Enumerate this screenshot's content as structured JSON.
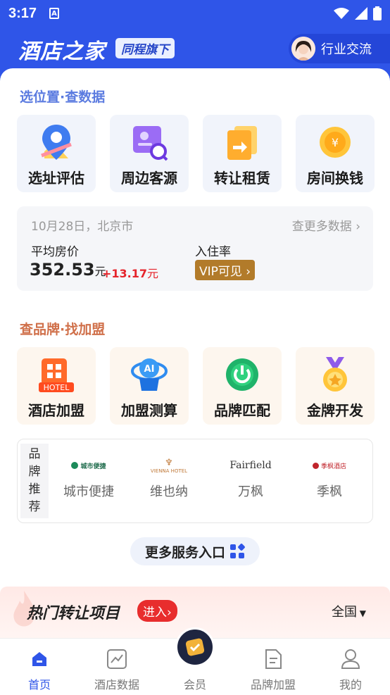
{
  "status": {
    "time": "3:17"
  },
  "header": {
    "logo": "酒店之家",
    "badge": "同程旗下",
    "industry": "行业交流"
  },
  "section1": {
    "title": "选位置·查数据",
    "tiles": [
      {
        "label": "选址评估",
        "icon": "map-pin-icon"
      },
      {
        "label": "周边客源",
        "icon": "customer-search-icon"
      },
      {
        "label": "转让租赁",
        "icon": "transfer-doc-icon"
      },
      {
        "label": "房间换钱",
        "icon": "coin-icon"
      }
    ]
  },
  "stats": {
    "date": "10月28日，北京市",
    "more": "查更多数据",
    "price_label": "平均房价",
    "price_value": "352.53",
    "price_unit": "元",
    "delta": "+13.17",
    "delta_unit": "元",
    "occupancy_label": "入住率",
    "vip": "VIP可见"
  },
  "section2": {
    "title": "查品牌·找加盟",
    "tiles": [
      {
        "label": "酒店加盟",
        "icon": "hotel-icon"
      },
      {
        "label": "加盟测算",
        "icon": "ai-robot-icon"
      },
      {
        "label": "品牌匹配",
        "icon": "power-match-icon"
      },
      {
        "label": "金牌开发",
        "icon": "gold-medal-icon"
      }
    ]
  },
  "brands": {
    "heading_chars": [
      "品",
      "牌",
      "推",
      "荐"
    ],
    "items": [
      {
        "name": "城市便捷",
        "logo": "城市便捷"
      },
      {
        "name": "维也纳",
        "logo": "VIENNA HOTEL"
      },
      {
        "name": "万枫",
        "logo": "Fairfield"
      },
      {
        "name": "季枫",
        "logo": "季枫酒店"
      }
    ]
  },
  "more_services": "更多服务入口",
  "hot": {
    "title": "热门转让项目",
    "enter": "进入",
    "region": "全国"
  },
  "tabbar": [
    {
      "label": "首页",
      "icon": "home-icon",
      "active": true
    },
    {
      "label": "酒店数据",
      "icon": "chart-icon"
    },
    {
      "label": "会员",
      "icon": "member-icon"
    },
    {
      "label": "品牌加盟",
      "icon": "brand-doc-icon"
    },
    {
      "label": "我的",
      "icon": "profile-icon"
    }
  ],
  "colors": {
    "primary": "#2f55e8",
    "section1_title": "#5b7be0",
    "section2_title": "#d0704a",
    "red": "#e5242b"
  }
}
